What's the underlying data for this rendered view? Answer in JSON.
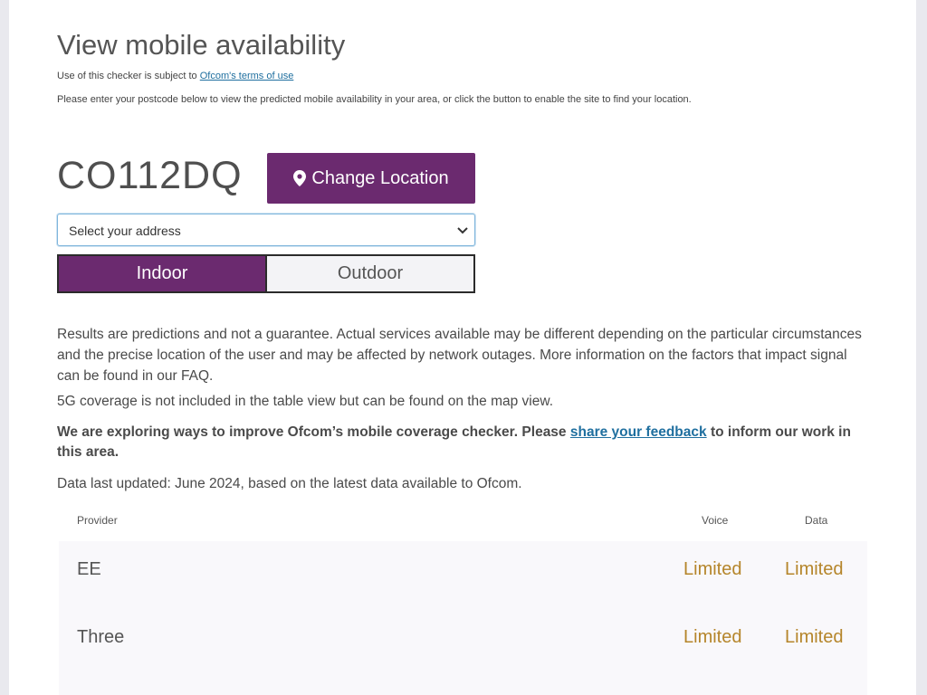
{
  "header": {
    "title": "View mobile availability",
    "terms_prefix": "Use of this checker is subject to",
    "terms_link": "Ofcom's terms of use",
    "intro": "Please enter your postcode below to view the predicted mobile availability in your area, or click the button to enable the site to find your location."
  },
  "location": {
    "postcode": "CO112DQ",
    "change_label": "Change Location",
    "address_select_value": "Select your address"
  },
  "toggle": {
    "indoor_label": "Indoor",
    "outdoor_label": "Outdoor",
    "selected": "Indoor"
  },
  "info": {
    "disclaimer": "Results are predictions and not a guarantee. Actual services available may be different depending on the particular circumstances and the precise location of the user and may be affected by network outages. More information on the factors that impact signal can be found in our FAQ.",
    "coverage_note": "5G coverage is not included in the table view but can be found on the map view.",
    "feedback_prefix": "We are exploring ways to improve Ofcom’s mobile coverage checker. Please",
    "feedback_link": "share your feedback",
    "feedback_suffix": "to inform our work in this area.",
    "updated": "Data last updated: June 2024, based on the latest data available to Ofcom."
  },
  "table": {
    "headers": {
      "provider": "Provider",
      "voice": "Voice",
      "data": "Data"
    },
    "rows": [
      {
        "provider": "EE",
        "voice": "Limited",
        "data": "Limited"
      },
      {
        "provider": "Three",
        "voice": "Limited",
        "data": "Limited"
      }
    ]
  },
  "colors": {
    "accent": "#6b2a6f",
    "link": "#1f6f9f",
    "limited": "#b5852a"
  },
  "icons": {
    "change_location": "map-marker-icon",
    "select": "chevron-down-icon"
  }
}
